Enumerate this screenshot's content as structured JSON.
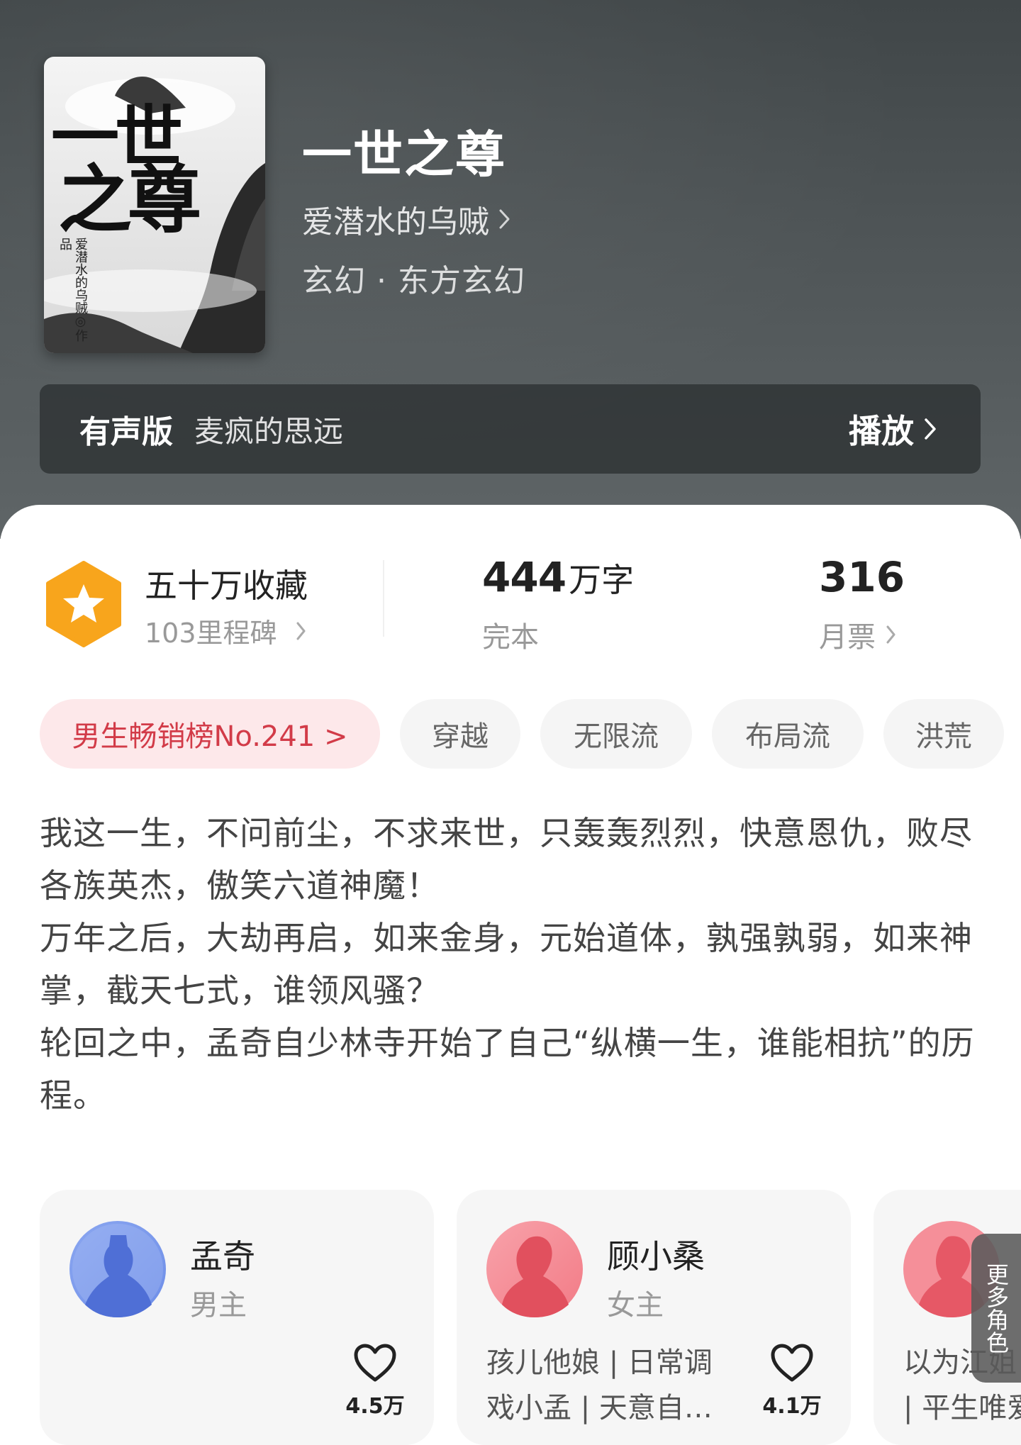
{
  "book": {
    "title": "一世之尊",
    "author": "爱潜水的乌贼",
    "genre": "玄幻 · 东方玄幻",
    "cover": {
      "title_line1": "一世",
      "title_line2": "之尊",
      "author_credit": "爱潜水的乌贼◎作品"
    }
  },
  "audio": {
    "label": "有声版",
    "narrator": "麦疯的思远",
    "play_label": "播放"
  },
  "stats": {
    "favorites_title": "五十万收藏",
    "milestones": "103里程碑",
    "word_count_number": "444",
    "word_count_unit": "万字",
    "status": "完本",
    "monthly_tickets": "316",
    "monthly_tickets_label": "月票"
  },
  "tags": {
    "rank": "男生畅销榜No.241 >",
    "items": [
      "穿越",
      "无限流",
      "布局流",
      "洪荒"
    ]
  },
  "synopsis": [
    "我这一生，不问前尘，不求来世，只轰轰烈烈，快意恩仇，败尽各族英杰，傲笑六道神魔！",
    "万年之后，大劫再启，如来金身，元始道体，孰强孰弱，如来神掌，截天七式，谁领风骚？",
    "轮回之中，孟奇自少林寺开始了自己“纵横一生，谁能相抗”的历程。"
  ],
  "roles": [
    {
      "name": "孟奇",
      "type": "男主",
      "desc_lines": [],
      "likes": "4.5万"
    },
    {
      "name": "顾小桑",
      "type": "女主",
      "desc_lines": [
        "孩儿他娘 | 日常调",
        "戏小孟 | 天意自…"
      ],
      "likes": "4.1万"
    },
    {
      "name": "",
      "type": "",
      "desc_lines": [
        "以为江姐",
        "| 平生唯爱"
      ],
      "likes": ""
    }
  ],
  "more_roles_label": "更多角色",
  "colors": {
    "rank_bg": "#fde8ea",
    "rank_text": "#d23b48",
    "star_badge": "#f8a51c",
    "male_avatar": "#6e8ee8",
    "female_avatar": "#f27b86"
  }
}
